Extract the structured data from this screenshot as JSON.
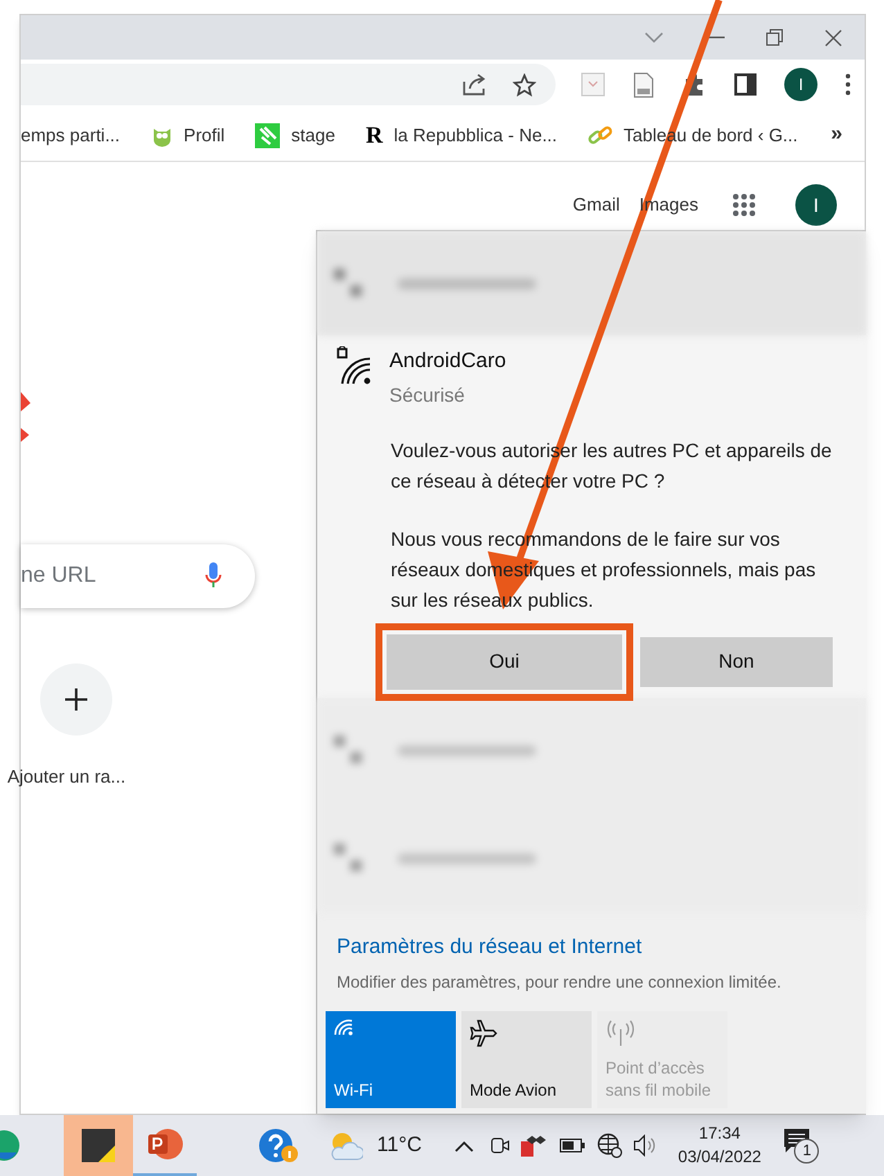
{
  "browser": {
    "bookmarks": [
      {
        "label": "emps parti...",
        "kind": "plain"
      },
      {
        "label": "Profil",
        "kind": "owl"
      },
      {
        "label": "stage",
        "kind": "green"
      },
      {
        "label": "la Repubblica - Ne...",
        "kind": "letter",
        "letter": "R"
      },
      {
        "label": "Tableau de bord ‹ G...",
        "kind": "link"
      }
    ],
    "more": "»",
    "profile_initial": "I"
  },
  "google_page": {
    "links": [
      "Gmail",
      "Images"
    ],
    "profile_initial": "I",
    "search_placeholder": "ne URL",
    "shortcut_label": "Ajouter un ra..."
  },
  "network_flyout": {
    "network": {
      "name": "AndroidCaro",
      "status": "Sécurisé",
      "question": "Voulez-vous autoriser les autres PC et appareils de ce réseau à détecter votre PC ?",
      "advice": "Nous vous recommandons de le faire sur vos réseaux domestiques et professionnels, mais pas sur les réseaux publics.",
      "buttons": [
        {
          "label": "Oui",
          "highlighted": true
        },
        {
          "label": "Non",
          "highlighted": false
        }
      ]
    },
    "settings_link": "Paramètres du réseau et Internet",
    "settings_hint": "Modifier des paramètres, pour rendre une connexion limitée.",
    "quick_actions": [
      {
        "kind": "wifi",
        "label": "Wi-Fi",
        "on": true,
        "disabled": false
      },
      {
        "kind": "airplane",
        "label": "Mode Avion",
        "on": false,
        "disabled": false
      },
      {
        "kind": "hotspot",
        "label": "Point d’accès sans fil mobile",
        "disabled": true
      }
    ]
  },
  "taskbar": {
    "temperature": "11°C",
    "time": "17:34",
    "date": "03/04/2022",
    "notification_count": "1"
  }
}
